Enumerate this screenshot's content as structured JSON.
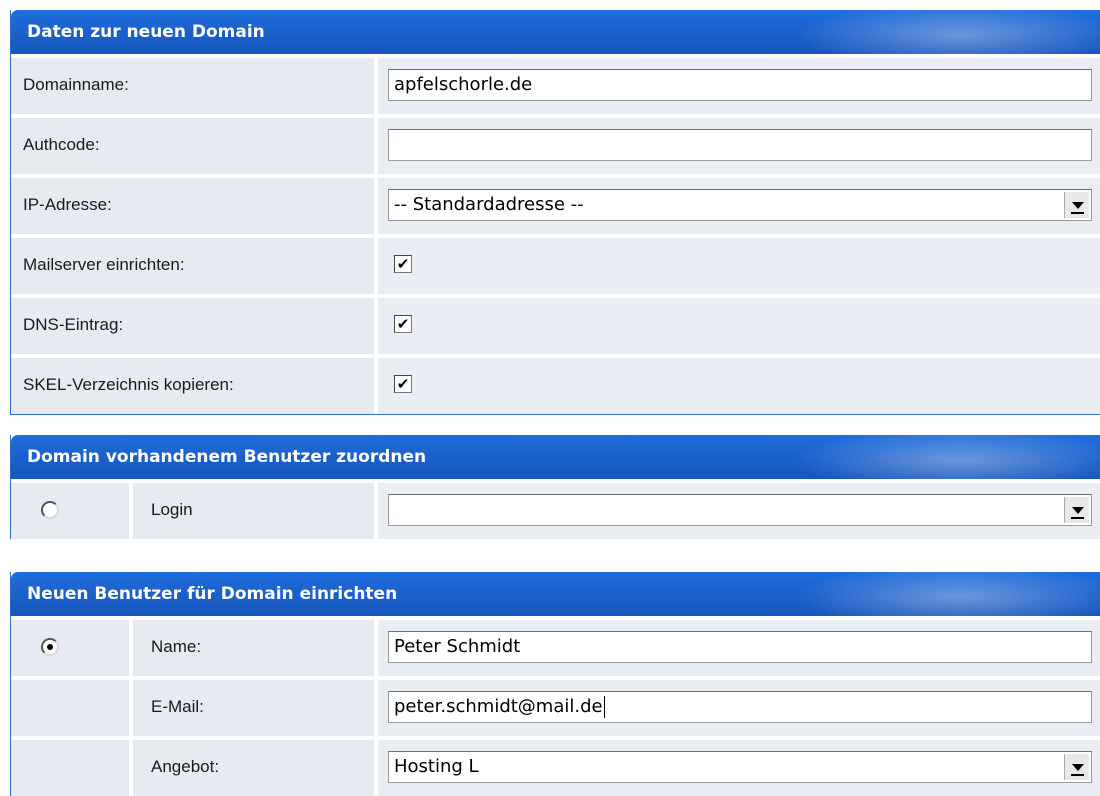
{
  "section1": {
    "title": "Daten zur neuen Domain",
    "domainname_label": "Domainname:",
    "domainname_value": "apfelschorle.de",
    "authcode_label": "Authcode:",
    "authcode_value": "",
    "ip_label": "IP-Adresse:",
    "ip_value": "-- Standardadresse --",
    "mailserver_label": "Mailserver einrichten:",
    "mailserver_checked": true,
    "dns_label": "DNS-Eintrag:",
    "dns_checked": true,
    "skel_label": "SKEL-Verzeichnis kopieren:",
    "skel_checked": true
  },
  "section2": {
    "title": "Domain vorhandenem Benutzer zuordnen",
    "radio_selected": false,
    "login_label": "Login",
    "login_value": ""
  },
  "section3": {
    "title": "Neuen Benutzer für Domain einrichten",
    "radio_selected": true,
    "name_label": "Name:",
    "name_value": "Peter Schmidt",
    "email_label": "E-Mail:",
    "email_value": "peter.schmidt@mail.de",
    "angebot_label": "Angebot:",
    "angebot_value": "Hosting L"
  },
  "icons": {
    "check": "✔",
    "dropdown": "dropdown-arrow-icon"
  }
}
